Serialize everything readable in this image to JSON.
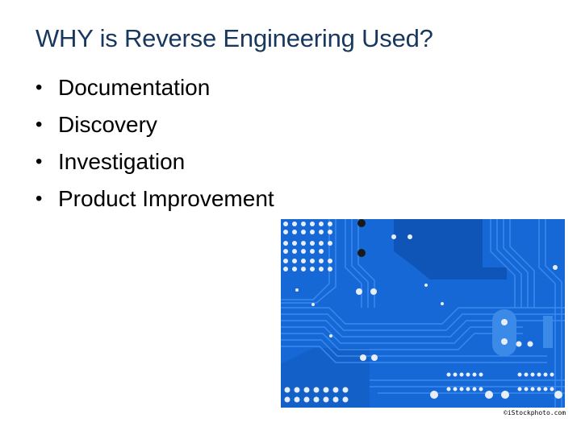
{
  "slide": {
    "title": "WHY is Reverse Engineering Used?",
    "bullets": [
      "Documentation",
      "Discovery",
      "Investigation",
      "Product Improvement"
    ],
    "bullet_glyph": "•",
    "image": {
      "description": "Blue printed circuit board close-up",
      "icon": "circuit-board-photo",
      "caption": "©iStockphoto.com"
    },
    "colors": {
      "title": "#17375e",
      "board": "#1668d6",
      "trace": "#3d8ef0"
    }
  }
}
